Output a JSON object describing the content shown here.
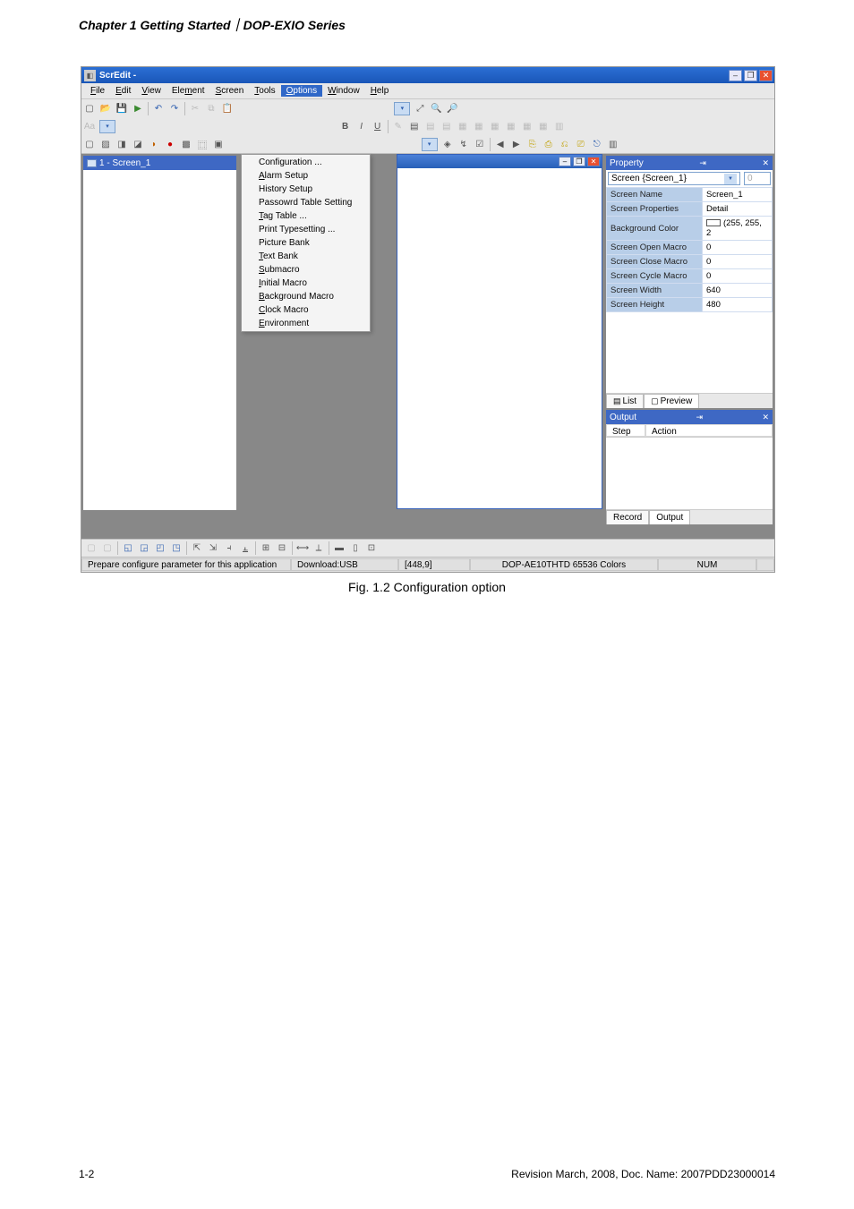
{
  "page": {
    "header": "Chapter 1 Getting Started｜DOP-EXIO Series",
    "caption": "Fig. 1.2 Configuration option",
    "number": "1-2",
    "docline": "Revision March, 2008, Doc. Name: 2007PDD23000014"
  },
  "titlebar": {
    "title": "ScrEdit -"
  },
  "menu": {
    "items": [
      {
        "pre": "",
        "hot": "F",
        "post": "ile"
      },
      {
        "pre": "",
        "hot": "E",
        "post": "dit"
      },
      {
        "pre": "",
        "hot": "V",
        "post": "iew"
      },
      {
        "pre": "Ele",
        "hot": "m",
        "post": "ent"
      },
      {
        "pre": "",
        "hot": "S",
        "post": "creen"
      },
      {
        "pre": "",
        "hot": "T",
        "post": "ools"
      },
      {
        "pre": "",
        "hot": "O",
        "post": "ptions"
      },
      {
        "pre": "",
        "hot": "W",
        "post": "indow"
      },
      {
        "pre": "",
        "hot": "H",
        "post": "elp"
      }
    ],
    "active_index": 6
  },
  "options_menu": [
    {
      "pre": "",
      "hot": "",
      "post": "Configuration ..."
    },
    {
      "pre": "",
      "hot": "A",
      "post": "larm Setup"
    },
    {
      "pre": "",
      "hot": "",
      "post": "History Setup"
    },
    {
      "pre": "",
      "hot": "",
      "post": "Passowrd Table Setting"
    },
    {
      "pre": "",
      "hot": "T",
      "post": "ag Table ..."
    },
    {
      "pre": "",
      "hot": "",
      "post": "Print Typesetting ..."
    },
    {
      "pre": "",
      "hot": "",
      "post": "Picture Bank"
    },
    {
      "pre": "",
      "hot": "T",
      "post": "ext Bank"
    },
    {
      "pre": "",
      "hot": "S",
      "post": "ubmacro"
    },
    {
      "pre": "",
      "hot": "I",
      "post": "nitial Macro"
    },
    {
      "pre": "",
      "hot": "B",
      "post": "ackground Macro"
    },
    {
      "pre": "",
      "hot": "C",
      "post": "lock Macro"
    },
    {
      "pre": "",
      "hot": "E",
      "post": "nvironment"
    }
  ],
  "left_panel": {
    "header": "1 - Screen_1"
  },
  "property_panel": {
    "title": "Property",
    "dropdown": "Screen {Screen_1}",
    "spin_value": "0",
    "rows": [
      {
        "label": "Screen Name",
        "value": "Screen_1"
      },
      {
        "label": "Screen Properties",
        "value": "Detail"
      },
      {
        "label": "Background Color",
        "value": "(255, 255, 2",
        "swatch": true
      },
      {
        "label": "Screen Open Macro",
        "value": "0"
      },
      {
        "label": "Screen Close Macro",
        "value": "0"
      },
      {
        "label": "Screen Cycle Macro",
        "value": "0"
      },
      {
        "label": "Screen Width",
        "value": "640"
      },
      {
        "label": "Screen Height",
        "value": "480"
      }
    ],
    "tabs": [
      "List",
      "Preview"
    ],
    "active_tab_index": 1
  },
  "output_panel": {
    "title": "Output",
    "columns": [
      "Step",
      "Action"
    ],
    "tabs": [
      "Record",
      "Output"
    ],
    "active_tab_index": 1
  },
  "statusbar": {
    "help": "Prepare configure parameter for this application",
    "download": "Download:USB",
    "coord": "[448,9]",
    "model": "DOP-AE10THTD 65536 Colors",
    "num": "NUM"
  }
}
